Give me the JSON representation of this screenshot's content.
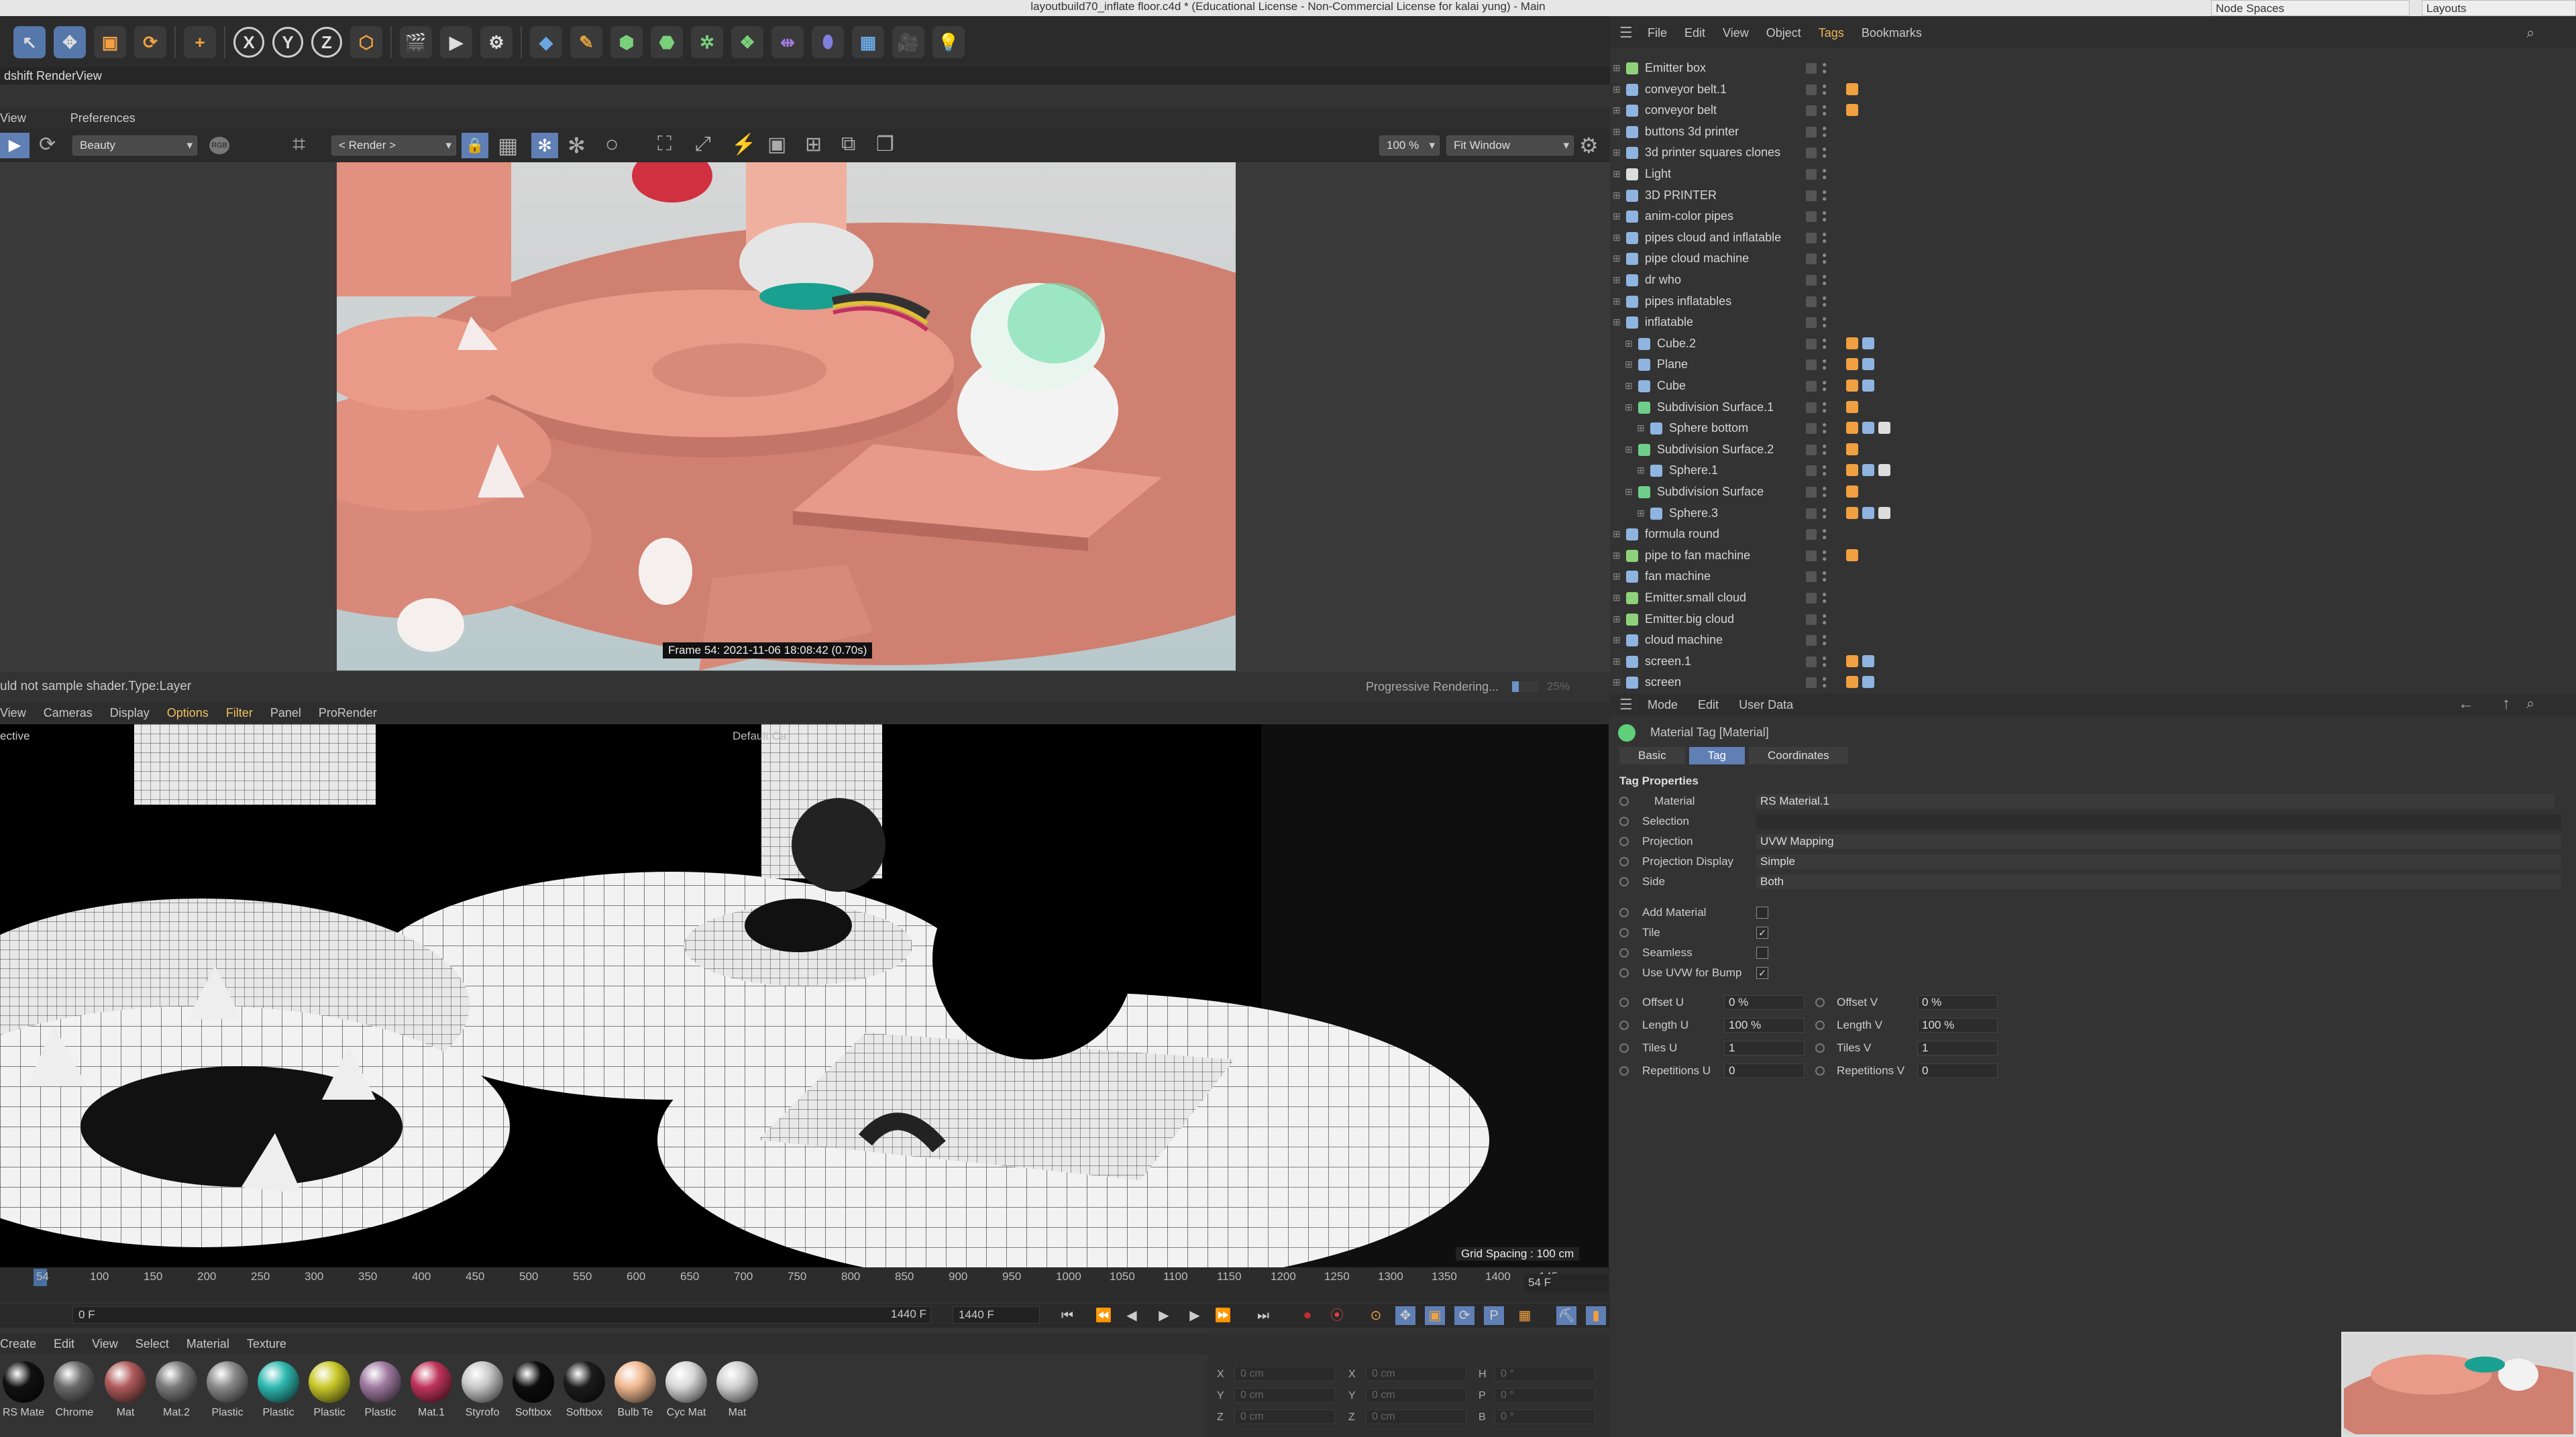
{
  "window_title": "layoutbuild70_inflate floor.c4d * (Educational License - Non-Commercial License for kalai yung) - Main",
  "node_spaces": "Node Spaces",
  "layouts": "Layouts",
  "renderview": {
    "title": "dshift RenderView",
    "menu": [
      "View",
      "Preferences"
    ],
    "aov": "Beauty",
    "render_mode": "< Render >",
    "zoom": "100 %",
    "fit": "Fit Window",
    "frame_label": "Frame  54:  2021-11-06  18:08:42  (0.70s)",
    "status_left": "uld not sample shader.Type:Layer",
    "status_right": "Progressive Rendering...",
    "progress_pct": "25%",
    "progress": 0.25
  },
  "viewport": {
    "menu": [
      "View",
      "Cameras",
      "Display",
      "Options",
      "Filter",
      "Panel",
      "ProRender"
    ],
    "perspective": "ective",
    "camera": "Default Ca",
    "grid_spacing": "Grid Spacing : 100 cm"
  },
  "timeline": {
    "ticks": [
      "54",
      "100",
      "150",
      "200",
      "250",
      "300",
      "350",
      "400",
      "450",
      "500",
      "550",
      "600",
      "650",
      "700",
      "750",
      "800",
      "850",
      "900",
      "950",
      "1000",
      "1050",
      "1100",
      "1150",
      "1200",
      "1250",
      "1300",
      "1350",
      "1400",
      "145"
    ],
    "current": "54 F",
    "start": "0 F",
    "end1": "1440 F",
    "end2": "1440 F"
  },
  "materials": {
    "menu": [
      "Create",
      "Edit",
      "View",
      "Select",
      "Material",
      "Texture"
    ],
    "items": [
      {
        "label": "RS Mate",
        "color": "#111111"
      },
      {
        "label": "Chrome",
        "color": "#6a6a6a"
      },
      {
        "label": "Mat",
        "color": "#b05a5a"
      },
      {
        "label": "Mat.2",
        "color": "#7a7a7a"
      },
      {
        "label": "Plastic",
        "color": "#8a8a8a"
      },
      {
        "label": "Plastic",
        "color": "#2fb9b0"
      },
      {
        "label": "Plastic",
        "color": "#c9c92a"
      },
      {
        "label": "Plastic",
        "color": "#a07aa0"
      },
      {
        "label": "Mat.1",
        "color": "#c0345a"
      },
      {
        "label": "Styrofo",
        "color": "#c8c8c8"
      },
      {
        "label": "Softbox",
        "color": "#0c0c0c"
      },
      {
        "label": "Softbox",
        "color": "#1c1c1c"
      },
      {
        "label": "Bulb Te",
        "color": "#f0b890"
      },
      {
        "label": "Cyc Mat",
        "color": "#d8d8d8"
      },
      {
        "label": "Mat",
        "color": "#cfcfcf"
      }
    ]
  },
  "coords": {
    "x_label": "X",
    "y_label": "Y",
    "z_label": "Z",
    "x": "0 cm",
    "y": "0 cm",
    "z": "0 cm",
    "x2": "0 cm",
    "y2": "0 cm",
    "z2": "0 cm",
    "h_label": "H",
    "p_label": "P",
    "b_label": "B",
    "h": "0 °",
    "p": "0 °",
    "b": "0 °"
  },
  "object_manager": {
    "menu": [
      "File",
      "Edit",
      "View",
      "Object",
      "Tags",
      "Bookmarks"
    ],
    "active_menu": "Tags",
    "rows": [
      {
        "name": "Emitter box",
        "indent": 0,
        "color": "#8fd17a"
      },
      {
        "name": "conveyor belt.1",
        "indent": 0,
        "color": "#8fb4e0"
      },
      {
        "name": "conveyor belt",
        "indent": 0,
        "color": "#8fb4e0"
      },
      {
        "name": "buttons 3d printer",
        "indent": 0,
        "color": "#8fb4e0"
      },
      {
        "name": "3d printer squares clones",
        "indent": 0,
        "color": "#8fb4e0"
      },
      {
        "name": "Light",
        "indent": 0,
        "color": "#dddddd"
      },
      {
        "name": "3D PRINTER",
        "indent": 0,
        "color": "#8fb4e0"
      },
      {
        "name": "anim-color pipes",
        "indent": 0,
        "color": "#8fb4e0"
      },
      {
        "name": "pipes cloud and inflatable",
        "indent": 0,
        "color": "#8fb4e0"
      },
      {
        "name": "pipe cloud machine",
        "indent": 0,
        "color": "#8fb4e0"
      },
      {
        "name": "dr who",
        "indent": 0,
        "color": "#8fb4e0"
      },
      {
        "name": "pipes inflatables",
        "indent": 0,
        "color": "#8fb4e0"
      },
      {
        "name": "inflatable",
        "indent": 0,
        "color": "#8fb4e0"
      },
      {
        "name": "Cube.2",
        "indent": 1,
        "color": "#8fb4e0"
      },
      {
        "name": "Plane",
        "indent": 1,
        "color": "#8fb4e0"
      },
      {
        "name": "Cube",
        "indent": 1,
        "color": "#8fb4e0"
      },
      {
        "name": "Subdivision Surface.1",
        "indent": 1,
        "color": "#6fcf8a"
      },
      {
        "name": "Sphere bottom",
        "indent": 2,
        "color": "#8fb4e0"
      },
      {
        "name": "Subdivision Surface.2",
        "indent": 1,
        "color": "#6fcf8a"
      },
      {
        "name": "Sphere.1",
        "indent": 2,
        "color": "#8fb4e0"
      },
      {
        "name": "Subdivision Surface",
        "indent": 1,
        "color": "#6fcf8a"
      },
      {
        "name": "Sphere.3",
        "indent": 2,
        "color": "#8fb4e0"
      },
      {
        "name": "formula round",
        "indent": 0,
        "color": "#8fb4e0"
      },
      {
        "name": "pipe to fan machine",
        "indent": 0,
        "color": "#8fd17a"
      },
      {
        "name": "fan machine",
        "indent": 0,
        "color": "#8fb4e0"
      },
      {
        "name": "Emitter.small cloud",
        "indent": 0,
        "color": "#8fd17a"
      },
      {
        "name": "Emitter.big cloud",
        "indent": 0,
        "color": "#8fd17a"
      },
      {
        "name": "cloud machine",
        "indent": 0,
        "color": "#8fb4e0"
      },
      {
        "name": "screen.1",
        "indent": 0,
        "color": "#8fb4e0"
      },
      {
        "name": "screen",
        "indent": 0,
        "color": "#8fb4e0"
      }
    ]
  },
  "attributes": {
    "menu": [
      "Mode",
      "Edit",
      "User Data"
    ],
    "header": "Material Tag [Material]",
    "tabs": [
      "Basic",
      "Tag",
      "Coordinates"
    ],
    "active_tab": "Tag",
    "section": "Tag Properties",
    "material_label": "Material",
    "material_value": "RS Material.1",
    "selection_label": "Selection",
    "projection_label": "Projection",
    "projection_value": "UVW Mapping",
    "projection_display_label": "Projection Display",
    "projection_display_value": "Simple",
    "side_label": "Side",
    "side_value": "Both",
    "add_material_label": "Add Material",
    "tile_label": "Tile",
    "seamless_label": "Seamless",
    "uvw_bump_label": "Use UVW for Bump",
    "offset_u_label": "Offset U",
    "offset_u": "0 %",
    "offset_v_label": "Offset V",
    "offset_v": "0 %",
    "length_u_label": "Length U",
    "length_u": "100 %",
    "length_v_label": "Length V",
    "length_v": "100 %",
    "tiles_u_label": "Tiles U",
    "tiles_u": "1",
    "tiles_v_label": "Tiles V",
    "tiles_v": "1",
    "rep_u_label": "Repetitions U",
    "rep_u": "0",
    "rep_v_label": "Repetitions V",
    "rep_v": "0"
  }
}
